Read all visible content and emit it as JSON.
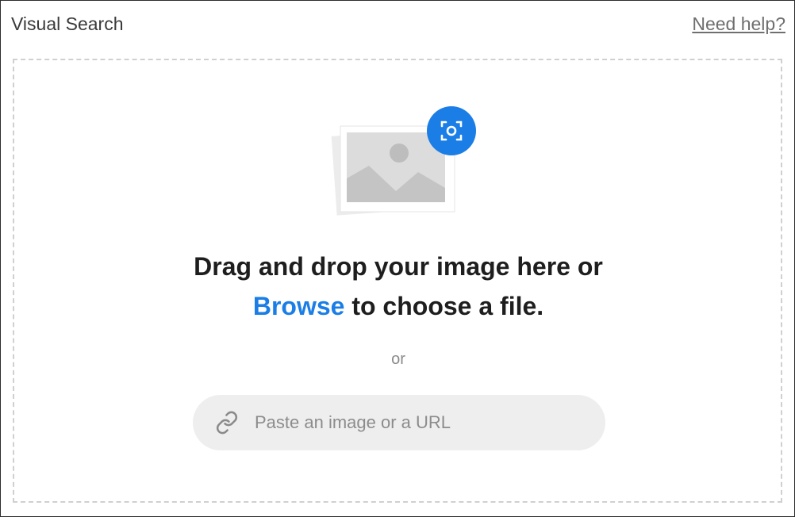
{
  "header": {
    "title": "Visual Search",
    "help_link": "Need help?"
  },
  "dropzone": {
    "line1": "Drag and drop your image here or",
    "browse_label": "Browse",
    "line2_rest": " to choose a file.",
    "or_label": "or",
    "url_input": {
      "value": "",
      "placeholder": "Paste an image or a URL"
    }
  },
  "icons": {
    "image_placeholder": "image-placeholder-icon",
    "scan": "camera-scan-icon",
    "link": "link-icon"
  },
  "colors": {
    "accent": "#1a7ee6",
    "title_text": "#3a3a3a",
    "help_text": "#6f6f6f",
    "input_bg": "#eeeeee",
    "dashed_border": "#d0d0d0"
  }
}
